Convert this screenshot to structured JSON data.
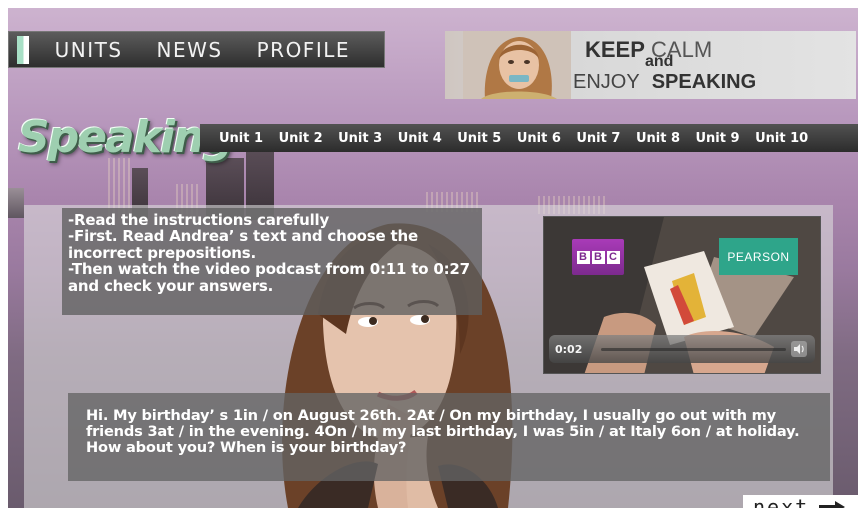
{
  "nav": {
    "items": [
      "UNITS",
      "NEWS",
      "PROFILE"
    ]
  },
  "banner": {
    "keep": "KEEP",
    "calm": "CALM",
    "and": "and",
    "enjoy": "ENJOY",
    "speaking": "SPEAKING"
  },
  "page": {
    "title": "Speaking"
  },
  "units": [
    "Unit 1",
    "Unit 2",
    "Unit 3",
    "Unit 4",
    "Unit 5",
    "Unit 6",
    "Unit 7",
    "Unit 8",
    "Unit 9",
    "Unit 10"
  ],
  "instructions": [
    "-Read the instructions carefully",
    "-First. Read Andrea’ s text and choose the incorrect prepositions.",
    "-Then watch the video podcast from 0:11 to 0:27 and check your answers."
  ],
  "video": {
    "bbc_letters": [
      "B",
      "B",
      "C"
    ],
    "pearson": "PEARSON",
    "time": "0:02"
  },
  "passage": "Hi. My birthday’ s 1in / on August 26th. 2At / On my birthday, I usually go out with my friends 3at / in the evening. 4On / In my last birthday, I was 5in / at Italy 6on / at holiday. How about you? When is your birthday?",
  "next_label": "next",
  "colors": {
    "title_green": "#9ecfb0",
    "bbc_purple": "#8e32a0",
    "pearson_teal": "#2ea58a"
  }
}
